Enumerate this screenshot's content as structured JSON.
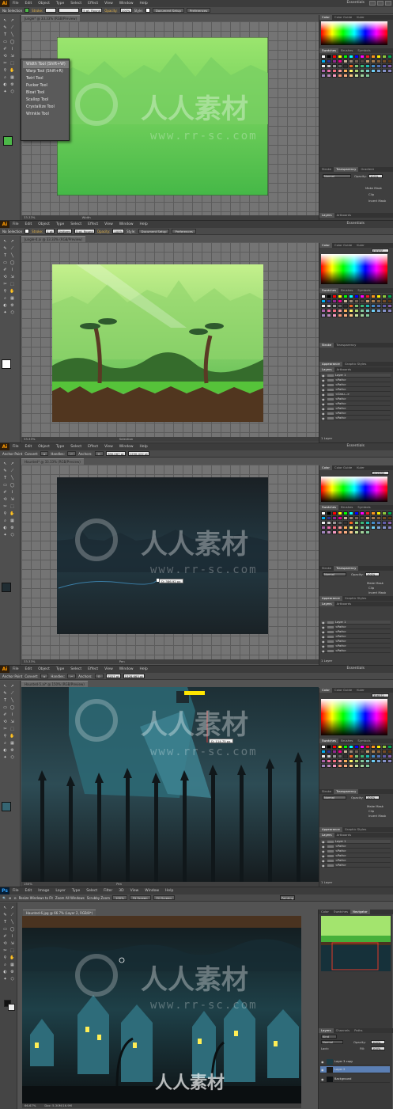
{
  "colors": {
    "ai_accent": "#ff9a00",
    "ps_accent": "#2fa3ff",
    "panel_bg": "#535353"
  },
  "panel1": {
    "menu": [
      "File",
      "Edit",
      "Object",
      "Type",
      "Select",
      "Effect",
      "View",
      "Window",
      "Help"
    ],
    "workspace": "Essentials",
    "control": {
      "selection": "No Selection",
      "stroke": "Stroke:",
      "brush": "5 pt. Round",
      "opacity_label": "Opacity:",
      "opacity": "100%",
      "style_label": "Style:",
      "doc_setup": "Document Setup",
      "prefs": "Preferences"
    },
    "doc_tab": "Jungle* @ 33.33% (RGB/Preview)",
    "flyout": [
      {
        "label": "Width Tool",
        "shortcut": "(Shift+W)"
      },
      {
        "label": "Warp Tool",
        "shortcut": "(Shift+R)"
      },
      {
        "label": "Twirl Tool",
        "shortcut": ""
      },
      {
        "label": "Pucker Tool",
        "shortcut": ""
      },
      {
        "label": "Bloat Tool",
        "shortcut": ""
      },
      {
        "label": "Scallop Tool",
        "shortcut": ""
      },
      {
        "label": "Crystallize Tool",
        "shortcut": ""
      },
      {
        "label": "Wrinkle Tool",
        "shortcut": ""
      }
    ],
    "status": {
      "zoom": "33.33%",
      "tool": "Width"
    },
    "right_tabs": [
      "Color",
      "Color Guide",
      "Kuler"
    ],
    "swatch_tabs": [
      "Swatches",
      "Brushes",
      "Symbols"
    ],
    "stroke_tabs": [
      "Stroke",
      "Transparency",
      "Gradient"
    ],
    "blend": "Normal",
    "opacity_label": "Opacity:",
    "opacity": "100%",
    "mask": [
      "Make Mask",
      "Clip",
      "Invert Mask"
    ],
    "layer_tabs": [
      "Layers",
      "Artboards"
    ]
  },
  "panel2": {
    "menu": [
      "File",
      "Edit",
      "Object",
      "Type",
      "Select",
      "Effect",
      "View",
      "Window",
      "Help"
    ],
    "workspace": "Essentials",
    "control": {
      "selection": "No Selection",
      "stroke": "Stroke:",
      "stroke_w": "1 pt",
      "profile": "Uniform",
      "brush": "5 pt. Round",
      "opacity_label": "Opacity:",
      "opacity": "100%",
      "style_label": "Style:",
      "doc_setup": "Document Setup",
      "prefs": "Preferences"
    },
    "doc_tab": "Jungle-4.ai @ 33.33% (RGB/Preview)",
    "status": {
      "zoom": "33.33%",
      "tool": "Selection"
    },
    "hex": "FFFFFF",
    "right_tabs": [
      "Color",
      "Color Guide",
      "Kuler"
    ],
    "swatch_tabs": [
      "Swatches",
      "Brushes",
      "Symbols"
    ],
    "stroke_tabs": [
      "Stroke",
      "Transparency"
    ],
    "appearance_tabs": [
      "Appearance",
      "Graphic Styles"
    ],
    "layer_tabs": [
      "Layers",
      "Artboards"
    ],
    "layers": [
      "Layer 1",
      "<Path>",
      "<Path>",
      "<Path>",
      "<Grou...>",
      "<Path>",
      "<Path>",
      "<Path>",
      "<Path>",
      "<Path>"
    ],
    "layer_count": "1 Layer"
  },
  "panel3": {
    "menu": [
      "File",
      "Edit",
      "Object",
      "Type",
      "Select",
      "Effect",
      "View",
      "Window",
      "Help"
    ],
    "workspace": "Essentials",
    "control": {
      "anchor": "Anchor Point",
      "convert": "Convert:",
      "handles": "Handles:",
      "anchors": "Anchors:",
      "x": "386.067 pt",
      "y": "1290.422 pt"
    },
    "doc_tab": "Haunted* @ 33.33% (RGB/Preview)",
    "tooltip": "D: 386.92 px",
    "status": {
      "zoom": "33.33%",
      "tool": "Pen"
    },
    "hex": "202D33",
    "right_tabs": [
      "Color",
      "Color Guide",
      "Kuler"
    ],
    "swatch_tabs": [
      "Swatches",
      "Brushes",
      "Symbols"
    ],
    "stroke_tabs": [
      "Stroke",
      "Transparency"
    ],
    "blend": "Normal",
    "opacity_label": "Opacity:",
    "opacity": "100%",
    "mask": [
      "Make Mask",
      "Clip",
      "Invert Mask"
    ],
    "appearance_tabs": [
      "Appearance",
      "Graphic Styles"
    ],
    "layer_tabs": [
      "Layers",
      "Artboards"
    ],
    "layers": [
      "Layer 1",
      "<Path>",
      "<Path>",
      "<Path>",
      "<Path>",
      "<Path>",
      "<Path>"
    ],
    "layer_count": "1 Layer"
  },
  "panel4": {
    "menu": [
      "File",
      "Edit",
      "Object",
      "Type",
      "Select",
      "Effect",
      "View",
      "Window",
      "Help"
    ],
    "workspace": "Essentials",
    "control": {
      "anchor": "Anchor Point",
      "convert": "Convert:",
      "handles": "Handles:",
      "anchors": "Anchors:",
      "x": "2257 pt",
      "y": "1328.663 pt"
    },
    "doc_tab": "Haunted-5.ai* @ 150% (RGB/Preview)",
    "tooltip": "D: 114.75 px",
    "status": {
      "zoom": "150%",
      "tool": "Pen"
    },
    "hex": "356572",
    "right_tabs": [
      "Color",
      "Color Guide",
      "Kuler"
    ],
    "swatch_tabs": [
      "Swatches",
      "Brushes",
      "Symbols"
    ],
    "stroke_tabs": [
      "Stroke",
      "Transparency"
    ],
    "blend": "Normal",
    "opacity_label": "Opacity:",
    "opacity": "100%",
    "mask": [
      "Make Mask",
      "Clip",
      "Invert Mask"
    ],
    "appearance_tabs": [
      "Appearance",
      "Graphic Styles"
    ],
    "layer_tabs": [
      "Layers",
      "Artboards"
    ],
    "layers": [
      "Layer 1",
      "<Path>",
      "<Path>",
      "<Path>",
      "<Path>",
      "<Path>"
    ],
    "layer_count": "1 Layer"
  },
  "panel5": {
    "menu": [
      "File",
      "Edit",
      "Image",
      "Layer",
      "Type",
      "Select",
      "Filter",
      "3D",
      "View",
      "Window",
      "Help"
    ],
    "workspace": "Painting",
    "control": {
      "resize": "Resize Windows to Fit",
      "zoom_all": "Zoom All Windows",
      "scrubby": "Scrubby Zoom",
      "zoom": "100%",
      "fit": "Fit Screen",
      "fill": "Fill Screen"
    },
    "doc_tab": "Haunted-6.jpg @ 66.7% (Layer 2, RGB/8*)",
    "status": {
      "zoom": "66.67%",
      "doc": "Doc: 5.30M/16.9M"
    },
    "right_tabs": [
      "Color",
      "Swatches",
      "Navigator"
    ],
    "layer_tabs": [
      "Layers",
      "Channels",
      "Paths"
    ],
    "kind": "Kind",
    "blend": "Normal",
    "opacity_label": "Opacity:",
    "opacity": "100%",
    "lock": "Lock:",
    "fill_label": "Fill:",
    "fill": "100%",
    "layers": [
      "Layer 3 copy",
      "Layer 2",
      "Background"
    ]
  },
  "watermark": {
    "cn": "人人素材",
    "url": "www.rr-sc.com"
  }
}
